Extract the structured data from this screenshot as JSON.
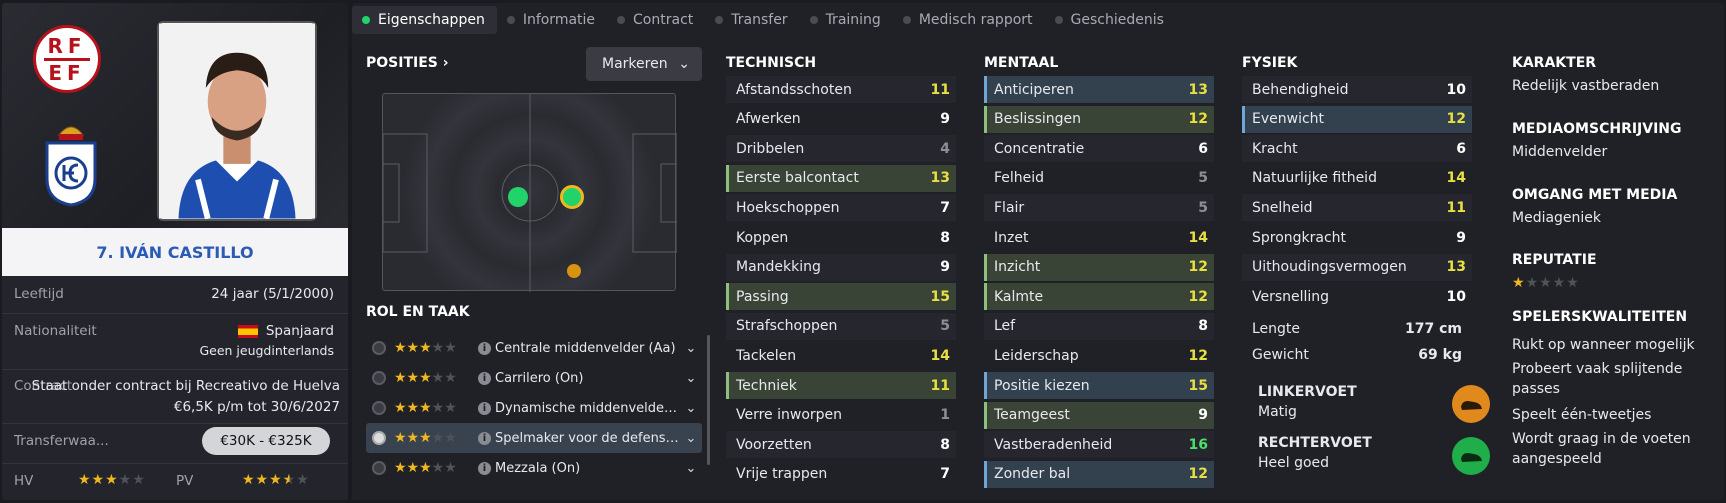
{
  "player": {
    "name": "7. IVÁN CASTILLO",
    "crest_text": [
      "RF",
      "EF"
    ],
    "age_label": "Leeftijd",
    "age_value": "24 jaar  (5/1/2000)",
    "nationality_label": "Nationaliteit",
    "nationality_value": "Spanjaard",
    "nationality_sub": "Geen jeugdinterlands",
    "contract_label": "Contract",
    "contract_value": "Staat onder contract bij Recreativo de Huelva",
    "contract_sub": "€6,5K p/m tot 30/6/2027",
    "transfer_label": "Transferwaa...",
    "transfer_value": "€30K - €325K",
    "hv_label": "HV",
    "pv_label": "PV",
    "hv_stars": 3,
    "pv_stars": 3.5,
    "colors": {
      "rfef_red": "#b5121b",
      "name_blue": "#2a5bb5"
    }
  },
  "tabs": [
    {
      "label": "Eigenschappen",
      "active": true
    },
    {
      "label": "Informatie"
    },
    {
      "label": "Contract"
    },
    {
      "label": "Transfer"
    },
    {
      "label": "Training"
    },
    {
      "label": "Medisch rapport"
    },
    {
      "label": "Geschiedenis"
    }
  ],
  "positions": {
    "title": "POSITIES",
    "mark_button": "Markeren"
  },
  "roles": {
    "title": "ROL EN TAAK",
    "items": [
      {
        "name": "Centrale middenvelder (Aa)",
        "stars": 3
      },
      {
        "name": "Carrilero (On)",
        "stars": 3
      },
      {
        "name": "Dynamische middenvelder (Aa)",
        "stars": 3
      },
      {
        "name": "Spelmaker voor de defensie (Aa)",
        "stars": 3,
        "selected": true
      },
      {
        "name": "Mezzala (On)",
        "stars": 3
      }
    ]
  },
  "technisch": {
    "title": "TECHNISCH",
    "attrs": [
      {
        "name": "Afstandsschoten",
        "value": 11
      },
      {
        "name": "Afwerken",
        "value": 9
      },
      {
        "name": "Dribbelen",
        "value": 4
      },
      {
        "name": "Eerste balcontact",
        "value": 13,
        "hl": "g"
      },
      {
        "name": "Hoekschoppen",
        "value": 7
      },
      {
        "name": "Koppen",
        "value": 8
      },
      {
        "name": "Mandekking",
        "value": 9
      },
      {
        "name": "Passing",
        "value": 15,
        "hl": "g"
      },
      {
        "name": "Strafschoppen",
        "value": 5
      },
      {
        "name": "Tackelen",
        "value": 14
      },
      {
        "name": "Techniek",
        "value": 11,
        "hl": "g"
      },
      {
        "name": "Verre inworpen",
        "value": 1
      },
      {
        "name": "Voorzetten",
        "value": 8
      },
      {
        "name": "Vrije trappen",
        "value": 7
      }
    ]
  },
  "mentaal": {
    "title": "MENTAAL",
    "attrs": [
      {
        "name": "Anticiperen",
        "value": 13,
        "hl": "b"
      },
      {
        "name": "Beslissingen",
        "value": 12,
        "hl": "g"
      },
      {
        "name": "Concentratie",
        "value": 6
      },
      {
        "name": "Felheid",
        "value": 5
      },
      {
        "name": "Flair",
        "value": 5
      },
      {
        "name": "Inzet",
        "value": 14
      },
      {
        "name": "Inzicht",
        "value": 12,
        "hl": "g"
      },
      {
        "name": "Kalmte",
        "value": 12,
        "hl": "g"
      },
      {
        "name": "Lef",
        "value": 8
      },
      {
        "name": "Leiderschap",
        "value": 12
      },
      {
        "name": "Positie kiezen",
        "value": 15,
        "hl": "b"
      },
      {
        "name": "Teamgeest",
        "value": 9,
        "hl": "g"
      },
      {
        "name": "Vastberadenheid",
        "value": 16
      },
      {
        "name": "Zonder bal",
        "value": 12,
        "hl": "b"
      }
    ]
  },
  "fysiek": {
    "title": "FYSIEK",
    "attrs": [
      {
        "name": "Behendigheid",
        "value": 10
      },
      {
        "name": "Evenwicht",
        "value": 12,
        "hl": "b"
      },
      {
        "name": "Kracht",
        "value": 6
      },
      {
        "name": "Natuurlijke fitheid",
        "value": 14
      },
      {
        "name": "Snelheid",
        "value": 11
      },
      {
        "name": "Sprongkracht",
        "value": 9
      },
      {
        "name": "Uithoudingsvermogen",
        "value": 13
      },
      {
        "name": "Versnelling",
        "value": 10
      }
    ],
    "length_label": "Lengte",
    "length_value": "177 cm",
    "weight_label": "Gewicht",
    "weight_value": "69 kg",
    "left_foot_label": "LINKERVOET",
    "left_foot_value": "Matig",
    "right_foot_label": "RECHTERVOET",
    "right_foot_value": "Heel goed",
    "foot_colors": {
      "left": "#e08a1e",
      "right": "#1fae4a"
    }
  },
  "profile": {
    "karakter_title": "KARAKTER",
    "karakter_value": "Redelijk vastberaden",
    "media_title": "MEDIAOMSCHRIJVING",
    "media_value": "Middenvelder",
    "omgang_title": "OMGANG MET MEDIA",
    "omgang_value": "Mediageniek",
    "reputatie_title": "REPUTATIE",
    "reputatie_stars": 1,
    "kwal_title": "SPELERSKWALITEITEN",
    "kwal_items": [
      "Rukt op wanneer mogelijk",
      "Probeert vaak splijtende passes",
      "Speelt één-tweetjes",
      "Wordt graag in de voeten aangespeeld"
    ]
  }
}
